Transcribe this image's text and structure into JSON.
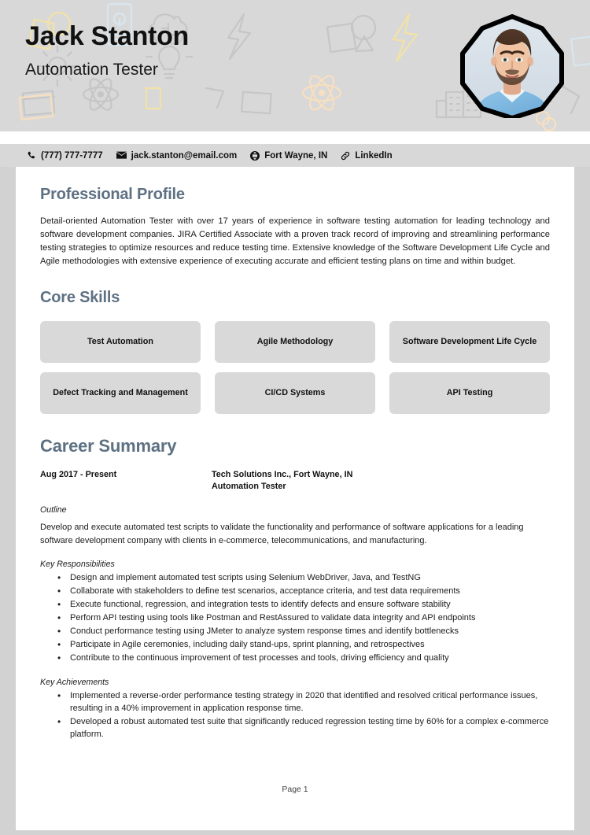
{
  "header": {
    "name": "Jack Stanton",
    "role": "Automation Tester",
    "photo_alt": "profile-photo"
  },
  "contact": [
    {
      "icon": "phone-icon",
      "label": "(777) 777-7777"
    },
    {
      "icon": "envelope-icon",
      "label": "jack.stanton@email.com"
    },
    {
      "icon": "globe-icon",
      "label": "Fort Wayne, IN"
    },
    {
      "icon": "link-icon",
      "label": "LinkedIn"
    }
  ],
  "profile": {
    "title": "Professional Profile",
    "text": "Detail-oriented Automation Tester with over 17 years of experience in software testing automation for leading technology and software development companies. JIRA Certified Associate with a proven track record of improving and streamlining performance testing strategies to optimize resources and reduce testing time. Extensive knowledge of the Software Development Life Cycle and Agile methodologies with extensive experience of executing accurate and efficient testing plans on time and within budget."
  },
  "core_skills": {
    "title": "Core Skills",
    "items": [
      "Test Automation",
      "Agile Methodology",
      "Software Development Life Cycle",
      "Defect Tracking and Management",
      "CI/CD Systems",
      "API Testing"
    ]
  },
  "career": {
    "title": "Career Summary",
    "jobs": [
      {
        "dates": "Aug 2017 - Present",
        "company": "Tech Solutions Inc., Fort Wayne, IN",
        "role": "Automation Tester",
        "outline_label": "Outline",
        "outline": "Develop and execute automated test scripts to validate the functionality and performance of software applications for a leading software development company with clients in e-commerce, telecommunications, and manufacturing.",
        "responsibilities_label": "Key Responsibilities",
        "responsibilities": [
          "Design and implement automated test scripts using Selenium WebDriver, Java, and TestNG",
          "Collaborate with stakeholders to define test scenarios, acceptance criteria, and test data requirements",
          "Execute functional, regression, and integration tests to identify defects and ensure software stability",
          "Perform API testing using tools like Postman and RestAssured to validate data integrity and API endpoints",
          "Conduct performance testing using JMeter to analyze system response times and identify bottlenecks",
          "Participate in Agile ceremonies, including daily stand-ups, sprint planning, and retrospectives",
          "Contribute to the continuous improvement of test processes and tools, driving efficiency and quality"
        ],
        "achievements_label": "Key Achievements",
        "achievements": [
          "Implemented a reverse-order performance testing strategy in 2020 that identified and resolved critical performance issues, resulting in a 40% improvement in application response time.",
          "Developed a robust automated test suite that significantly reduced regression testing time by 60% for a complex e-commerce platform."
        ]
      }
    ]
  },
  "footer": {
    "page_label": "Page 1"
  },
  "colors": {
    "page_background": "#d2d2d2",
    "header_background": "#d8d8d8",
    "card_background": "#ffffff",
    "heading": "#5d7183",
    "skill_chip": "#d9d9d9",
    "text": "#1c1c1c"
  }
}
